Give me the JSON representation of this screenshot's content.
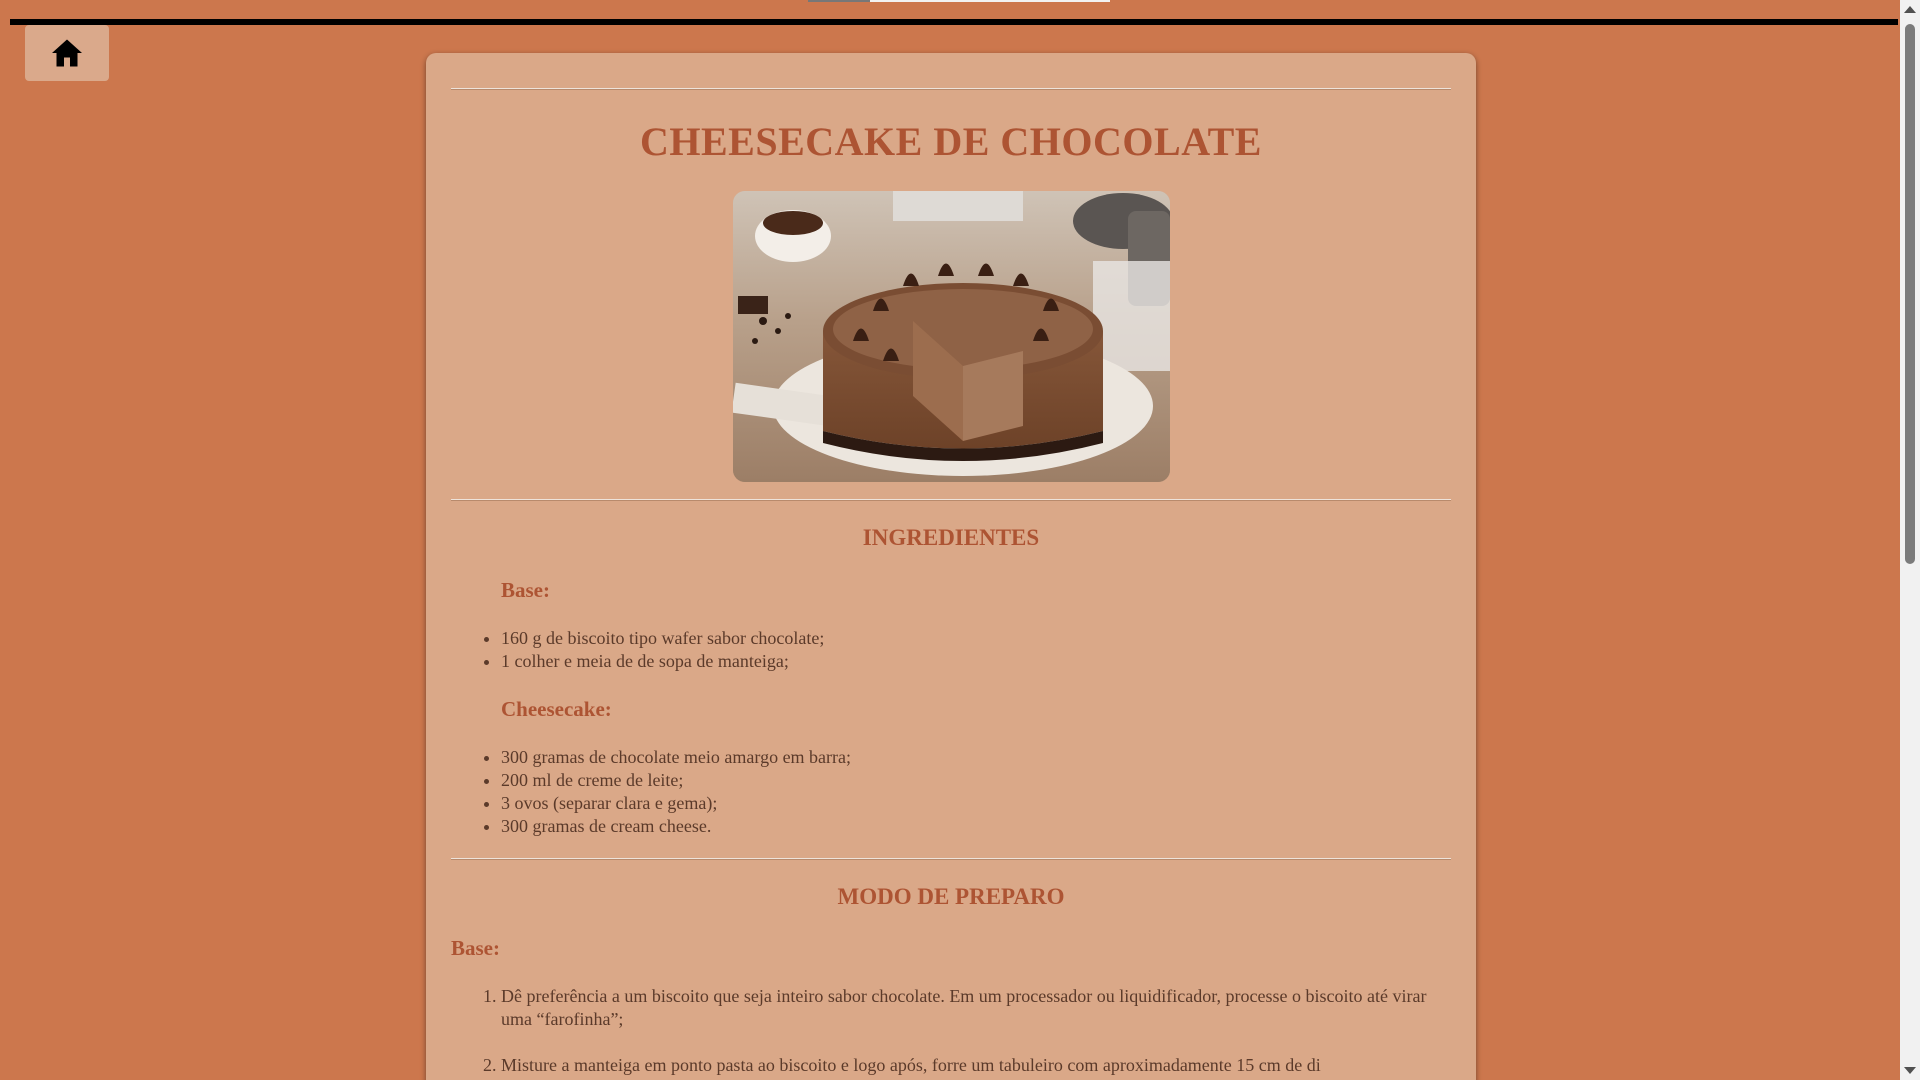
{
  "nav": {
    "home_icon": "home-icon"
  },
  "recipe": {
    "title": "CHEESECAKE DE CHOCOLATE",
    "image_description": "chocolate cheesecake photo",
    "ingredients": {
      "heading": "INGREDIENTES",
      "groups": [
        {
          "title": "Base:",
          "items": [
            "160 g de biscoito tipo wafer sabor chocolate;",
            "1 colher e meia de de sopa de manteiga;"
          ]
        },
        {
          "title": "Cheesecake:",
          "items": [
            "300 gramas de chocolate meio amargo em barra;",
            "200 ml de creme de leite;",
            "3 ovos (separar clara e gema);",
            "300 gramas de cream cheese."
          ]
        }
      ]
    },
    "preparation": {
      "heading": "MODO DE PREPARO",
      "groups": [
        {
          "title": "Base:",
          "steps": [
            "Dê preferência a um biscoito que seja inteiro sabor chocolate. Em um processador ou liquidificador, processe o biscoito até virar uma “farofinha”;",
            "Misture a manteiga em ponto pasta ao biscoito e logo após, forre um tabuleiro com aproximadamente 15 cm de di"
          ]
        }
      ]
    }
  },
  "colors": {
    "background": "#cc774d",
    "card": "#daa888",
    "heading": "#ad5433",
    "text": "#5b3a2a"
  }
}
